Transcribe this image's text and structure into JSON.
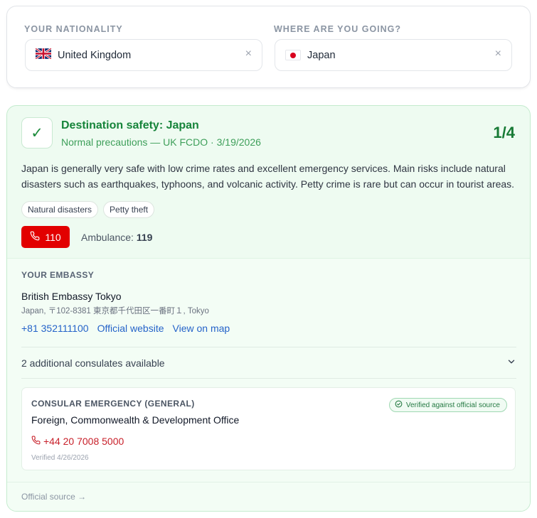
{
  "nationality": {
    "label": "YOUR NATIONALITY",
    "value": "United Kingdom",
    "flag_icon": "uk-flag-icon",
    "clear": "×"
  },
  "destination": {
    "label": "WHERE ARE YOU GOING?",
    "value": "Japan",
    "flag_icon": "japan-flag-icon",
    "clear": "×"
  },
  "safety": {
    "check": "✓",
    "title": "Destination safety: Japan",
    "subtitle": "Normal precautions — UK FCDO · 3/19/2026",
    "level": "1/4",
    "summary": "Japan is generally very safe with low crime rates and excellent emergency services. Main risks include natural disasters such as earthquakes, typhoons, and volcanic activity. Petty crime is rare but can occur in tourist areas.",
    "tags": [
      "Natural disasters",
      "Petty theft"
    ],
    "police_number": "110",
    "ambulance_label": "Ambulance:",
    "ambulance_number": "119",
    "accent_color": "#16843a",
    "emergency_color": "#e20000"
  },
  "embassy": {
    "label": "YOUR EMBASSY",
    "name": "British Embassy Tokyo",
    "address": "Japan, 〒102-8381 東京都千代田区一番町１, Tokyo",
    "phone": "+81 352111100",
    "website_label": "Official website",
    "map_label": "View on map",
    "consulates_text": "2 additional consulates available"
  },
  "consular_emergency": {
    "label": "CONSULAR EMERGENCY (GENERAL)",
    "organization": "Foreign, Commonwealth & Development Office",
    "phone": "+44 20 7008 5000",
    "verified_date": "Verified 4/26/2026",
    "badge": "Verified against official source"
  },
  "footer": {
    "official_source": "Official source →"
  }
}
